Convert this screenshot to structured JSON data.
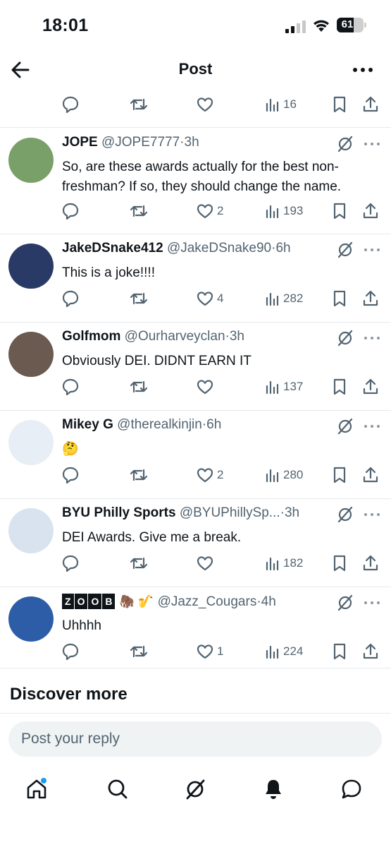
{
  "status_bar": {
    "time": "18:01",
    "battery": "61"
  },
  "header": {
    "title": "Post"
  },
  "top_actions": {
    "views": "16"
  },
  "replies": [
    {
      "name": "JOPE",
      "handle": "@JOPE7777",
      "time": "3h",
      "text": "So, are these awards actually for the best non-freshman?  If so, they should change the name.",
      "likes": "2",
      "views": "193",
      "avatar_bg": "#7aa06a"
    },
    {
      "name": "JakeDSnake412",
      "handle": "@JakeDSnake90",
      "time": "6h",
      "text": "This is a joke!!!!",
      "likes": "4",
      "views": "282",
      "avatar_bg": "#2a3a66"
    },
    {
      "name": "Golfmom",
      "handle": "@Ourharveyclan",
      "time": "3h",
      "text": "Obviously DEI. DIDNT EARN IT",
      "likes": "",
      "views": "137",
      "avatar_bg": "#6a5a50"
    },
    {
      "name": "Mikey G",
      "handle": "@therealkinjin",
      "time": "6h",
      "text": "🤔",
      "likes": "2",
      "views": "280",
      "avatar_bg": "#e8eef5"
    },
    {
      "name": "BYU Philly Sports",
      "handle": "@BYUPhillySp...",
      "time": "3h",
      "text": "DEI Awards. Give me a break.",
      "likes": "",
      "views": "182",
      "avatar_bg": "#d9e3ef"
    },
    {
      "name_badge": [
        "Z",
        "O",
        "O",
        "B"
      ],
      "name_emojis": "🦣 🎷",
      "handle": "@Jazz_Cougars",
      "time": "4h",
      "text": "Uhhhh",
      "likes": "1",
      "views": "224",
      "avatar_bg": "#2e5da8"
    }
  ],
  "time_separator": "·",
  "discover": {
    "title": "Discover more"
  },
  "reply_input": {
    "placeholder": "Post your reply"
  },
  "colors": {
    "text": "#0f1419",
    "secondary": "#536471",
    "accent": "#1d9bf0",
    "divider": "#e6e9ec"
  },
  "nav": {
    "items": [
      "home-icon",
      "search-icon",
      "grok-icon",
      "notifications-icon",
      "messages-icon"
    ]
  }
}
